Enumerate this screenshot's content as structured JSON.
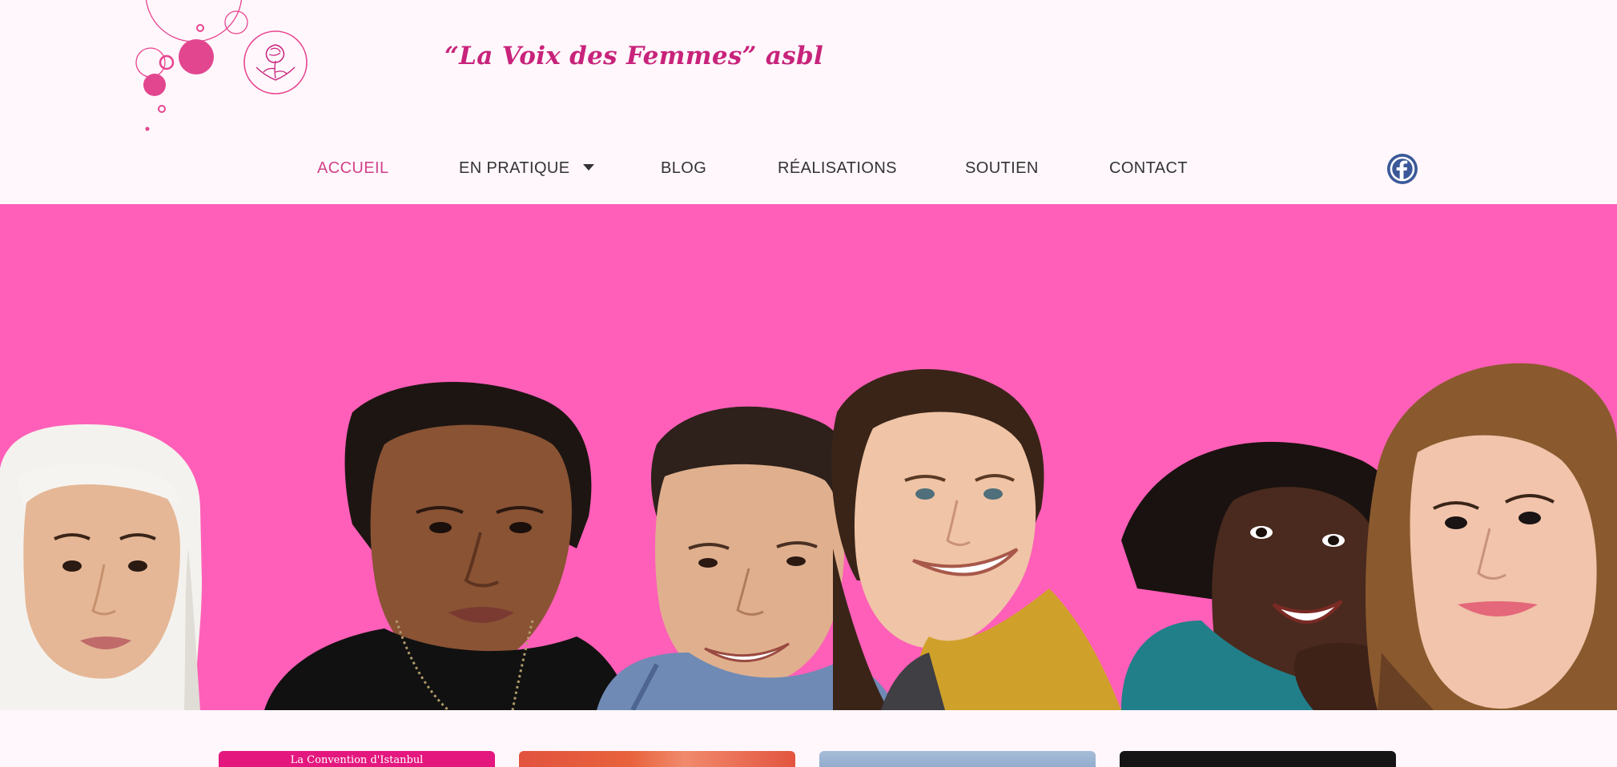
{
  "brand": {
    "name": "“La Voix des Femmes” asbl",
    "logo_icon": "rose-circle-logo"
  },
  "nav": {
    "items": [
      {
        "label": "ACCUEIL",
        "active": true
      },
      {
        "label": "EN PRATIQUE",
        "has_dropdown": true
      },
      {
        "label": "BLOG"
      },
      {
        "label": "RÉALISATIONS"
      },
      {
        "label": "SOUTIEN"
      },
      {
        "label": "CONTACT"
      }
    ],
    "social_icon": "facebook-icon"
  },
  "hero": {
    "image": "group-of-six-smiling-women",
    "background_color": "#ff5fb8"
  },
  "cards": [
    {
      "title": "La Convention d'Istanbul"
    },
    {
      "title": ""
    },
    {
      "title": ""
    },
    {
      "title": ""
    }
  ],
  "colors": {
    "accent": "#d2418a",
    "brand_pink": "#c8237b",
    "page_background": "#fff7fc",
    "facebook_blue": "#3b5998"
  }
}
